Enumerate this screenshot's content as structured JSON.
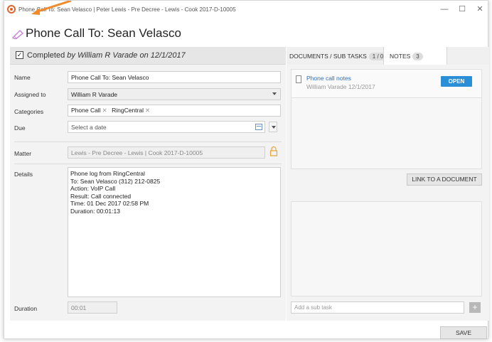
{
  "window": {
    "title": "Phone Call To: Sean Velasco | Peter Lewis - Pre Decree - Lewis - Cook 2017-D-10005",
    "minimize_glyph": "—",
    "maximize_glyph": "☐",
    "close_glyph": "✕"
  },
  "heading": {
    "icon": "phone-call-edit-icon",
    "title": "Phone Call To: Sean Velasco"
  },
  "completed": {
    "checked": true,
    "check_glyph": "✓",
    "label": "Completed",
    "detail": "by William R Varade on 12/1/2017"
  },
  "form": {
    "name_label": "Name",
    "name_value": "Phone Call To: Sean Velasco",
    "assigned_label": "Assigned to",
    "assigned_value": "William R Varade",
    "categories_label": "Categories",
    "categories": [
      "Phone Call",
      "RingCentral"
    ],
    "tag_remove_glyph": "✕",
    "due_label": "Due",
    "due_placeholder": "Select a date",
    "matter_label": "Matter",
    "matter_value": "Lewis - Pre Decree - Lewis | Cook 2017-D-10005",
    "details_label": "Details",
    "details_lines": [
      "Phone log from RingCentral",
      "To: Sean Velasco (312) 212-0825",
      "Action: VoIP Call",
      "Result: Call connected",
      "Time: 01 Dec 2017 02:58 PM",
      "Duration: 00:01:13"
    ],
    "duration_label": "Duration",
    "duration_value": "00:01"
  },
  "tabs": [
    {
      "label": "DOCUMENTS / SUB TASKS",
      "badge": "1 / 0"
    },
    {
      "label": "NOTES",
      "badge": "3"
    }
  ],
  "documents": [
    {
      "title": "Phone call notes",
      "subtitle": "William Varade 12/1/2017",
      "action": "OPEN"
    }
  ],
  "link_document_label": "LINK TO A DOCUMENT",
  "subtask": {
    "placeholder": "Add a sub task",
    "add_glyph": "+"
  },
  "save_label": "SAVE",
  "colors": {
    "accent": "#2b8fd8",
    "brand": "#e0632a",
    "heading_icon": "#c58bd8"
  }
}
